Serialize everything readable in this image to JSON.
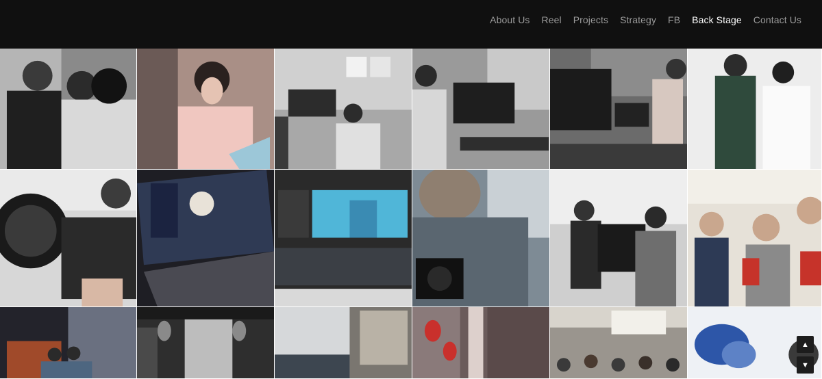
{
  "nav": {
    "items": [
      {
        "label": "About Us",
        "active": false
      },
      {
        "label": "Reel",
        "active": false
      },
      {
        "label": "Projects",
        "active": false
      },
      {
        "label": "Strategy",
        "active": false
      },
      {
        "label": "FB",
        "active": false
      },
      {
        "label": "Back Stage",
        "active": true
      },
      {
        "label": "Contact Us",
        "active": false
      }
    ]
  },
  "gallery": {
    "photos": [
      {
        "name": "photo-crew-portrait-bw",
        "bg": "#7a7a7a"
      },
      {
        "name": "photo-actress-reading",
        "bg": "#c9a89a"
      },
      {
        "name": "photo-camera-rig-set-bw",
        "bg": "#8c8c8c"
      },
      {
        "name": "photo-camera-operator-bw",
        "bg": "#7d7d7d"
      },
      {
        "name": "photo-monitor-actress-bw",
        "bg": "#6e6e6e"
      },
      {
        "name": "photo-duo-portrait-white",
        "bg": "#e9e9e9"
      },
      {
        "name": "photo-canon-lens-camera",
        "bg": "#3a3a3a"
      },
      {
        "name": "photo-laptop-3d-head",
        "bg": "#2b2f38"
      },
      {
        "name": "photo-editing-software-screen",
        "bg": "#1c1c1c"
      },
      {
        "name": "photo-person-sony-camera",
        "bg": "#6d7a86"
      },
      {
        "name": "photo-steadicam-crew-bw",
        "bg": "#bdbdbd"
      },
      {
        "name": "photo-group-selfie",
        "bg": "#d8d2c8"
      },
      {
        "name": "photo-brick-wall-night",
        "bg": "#2a2a33"
      },
      {
        "name": "photo-alley-lanterns-bw",
        "bg": "#4a4a4a"
      },
      {
        "name": "photo-building-sign",
        "bg": "#9a9a96"
      },
      {
        "name": "photo-red-lanterns-alley",
        "bg": "#5a4848"
      },
      {
        "name": "photo-crowd-cafeteria",
        "bg": "#8a857e"
      },
      {
        "name": "photo-blue-ink-paper",
        "bg": "#e6ecf3"
      }
    ]
  },
  "controls": {
    "scroll_up_icon": "triangle-up",
    "scroll_down_icon": "triangle-down"
  }
}
